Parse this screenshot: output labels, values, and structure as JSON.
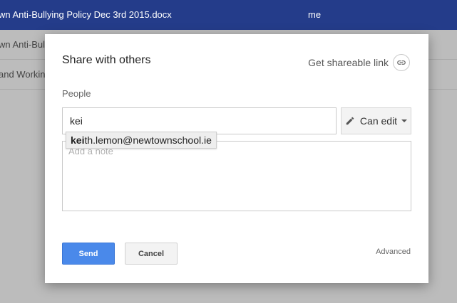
{
  "background": {
    "rows": [
      {
        "name": "wn Anti-Bullying Policy Dec 3rd 2015.docx",
        "owner": "me"
      },
      {
        "name": "wn Anti-Bully",
        "owner": ""
      },
      {
        "name": "and Working",
        "owner": ""
      }
    ]
  },
  "dialog": {
    "title": "Share with others",
    "shareable_link_label": "Get shareable link",
    "people_label": "People",
    "people_input_value": "kei",
    "permission_label": "Can edit",
    "note_placeholder": "Add a note",
    "suggestion": {
      "match": "kei",
      "rest": "th.lemon@newtownschool.ie"
    },
    "send_label": "Send",
    "cancel_label": "Cancel",
    "advanced_label": "Advanced"
  },
  "colors": {
    "selected_row": "#243c8a",
    "send_button": "#4a89ea",
    "overlay": "#bcbcbc"
  },
  "icons": {
    "shareable_link": "link-icon",
    "permission": "pencil-icon",
    "dropdown": "caret-down-icon"
  }
}
